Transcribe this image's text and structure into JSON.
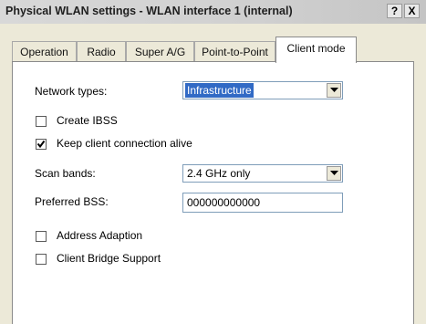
{
  "window": {
    "title": "Physical WLAN settings - WLAN interface 1 (internal)",
    "help_label": "?",
    "close_label": "X"
  },
  "tabs": [
    {
      "label": "Operation",
      "active": false
    },
    {
      "label": "Radio",
      "active": false
    },
    {
      "label": "Super A/G",
      "active": false
    },
    {
      "label": "Point-to-Point",
      "active": false
    },
    {
      "label": "Client mode",
      "active": true
    }
  ],
  "client_mode": {
    "network_types": {
      "label": "Network types:",
      "value": "Infrastructure"
    },
    "create_ibss": {
      "label": "Create IBSS",
      "checked": false
    },
    "keep_alive": {
      "label": "Keep client connection alive",
      "checked": true
    },
    "scan_bands": {
      "label": "Scan bands:",
      "value": "2.4 GHz only"
    },
    "preferred_bss": {
      "label": "Preferred BSS:",
      "value": "000000000000"
    },
    "address_adaption": {
      "label": "Address Adaption",
      "checked": false
    },
    "client_bridge_support": {
      "label": "Client Bridge Support",
      "checked": false
    }
  }
}
